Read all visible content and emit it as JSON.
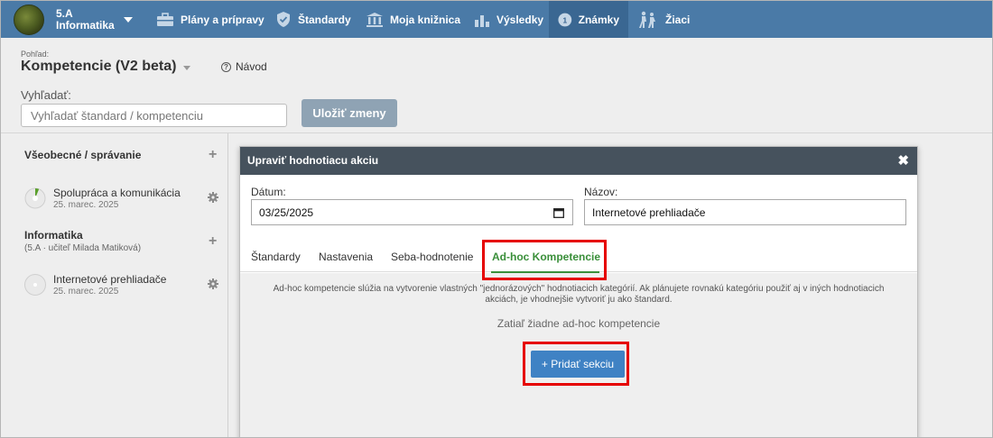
{
  "topbar": {
    "class_name": "5.A",
    "subject": "Informatika",
    "nav": [
      {
        "label": "Plány a prípravy",
        "icon": "briefcase-icon"
      },
      {
        "label": "Štandardy",
        "icon": "shield-check-icon"
      },
      {
        "label": "Moja knižnica",
        "icon": "library-icon"
      },
      {
        "label": "Výsledky",
        "icon": "bar-chart-icon"
      },
      {
        "label": "Známky",
        "icon": "grade-icon",
        "active": true
      },
      {
        "label": "Žiaci",
        "icon": "students-icon"
      }
    ]
  },
  "header": {
    "view_label": "Pohľad:",
    "view_title": "Kompetencie (V2 beta)",
    "help_label": "Návod",
    "search_label": "Vyhľadať:",
    "search_placeholder": "Vyhľadať štandard / kompetenciu",
    "save_label": "Uložiť zmeny"
  },
  "left_panel": {
    "sections": [
      {
        "title": "Všeobecné / správanie",
        "items": [
          {
            "title": "Spolupráca a komunikácia",
            "date": "25. marec. 2025"
          }
        ]
      },
      {
        "title": "Informatika",
        "subtitle": "(5.A · učiteľ Milada Matiková)",
        "items": [
          {
            "title": "Internetové prehliadače",
            "date": "25. marec. 2025"
          }
        ]
      }
    ]
  },
  "modal": {
    "title": "Upraviť hodnotiacu akciu",
    "close": "✖",
    "date_label": "Dátum:",
    "date_value": "03/25/2025",
    "name_label": "Názov:",
    "name_value": "Internetové prehliadače",
    "tabs": [
      "Štandardy",
      "Nastavenia",
      "Seba-hodnotenie",
      "Ad-hoc Kompetencie"
    ],
    "active_tab": "Ad-hoc Kompetencie",
    "info_text": "Ad-hoc kompetencie slúžia na vytvorenie vlastných \"jednorázových\" hodnotiacich kategórií. Ak plánujete rovnakú kategóriu použiť aj v iných hodnotiacich akciách, je vhodnejšie vytvoriť ju ako štandard.",
    "empty_text": "Zatiaľ žiadne ad-hoc kompetencie",
    "add_section_label": "+ Pridať sekciu"
  },
  "colors": {
    "topbar": "#4a7aa7",
    "topbar_active": "#3a6792",
    "modal_header": "#46525d",
    "accent_green": "#3a8f3a",
    "primary_button": "#3f82c4",
    "highlight": "#e60000"
  }
}
